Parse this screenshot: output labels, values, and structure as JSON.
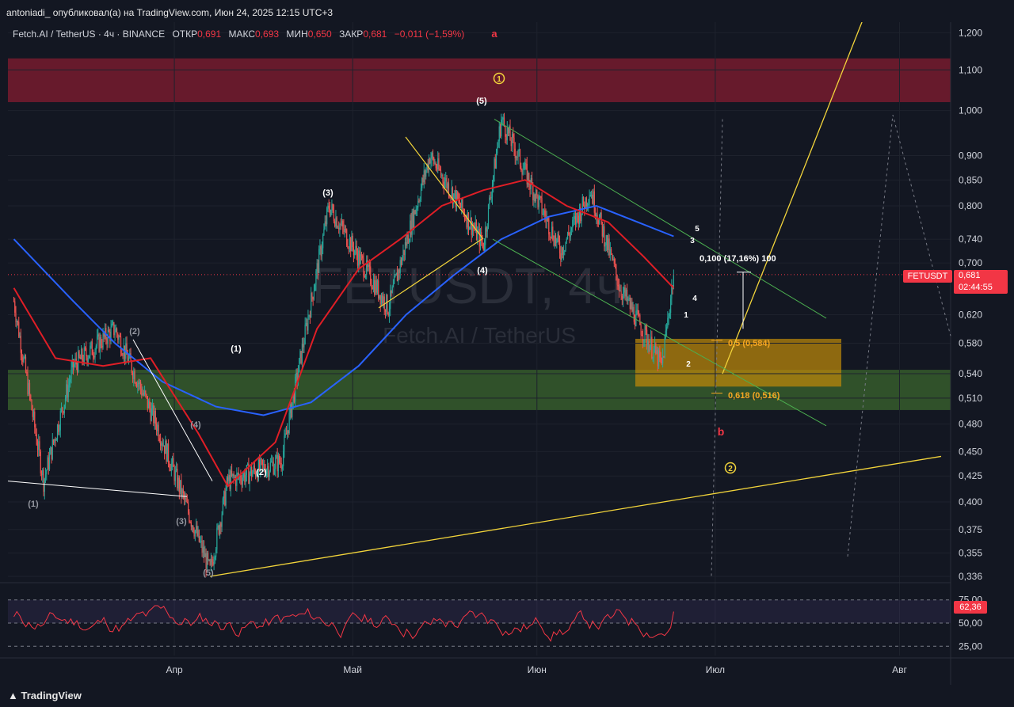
{
  "header": {
    "publisher": "antoniadi_ опубликовал(а) на TradingView.com, Июн 24, 2025 12:15 UTC+3"
  },
  "legend": {
    "symbol": "Fetch.AI / TetherUS · 4ч · BINANCE",
    "open_label": "ОТКР",
    "open": "0,691",
    "high_label": "МАКС",
    "high": "0,693",
    "low_label": "МИН",
    "low": "0,650",
    "close_label": "ЗАКР",
    "close": "0,681",
    "change": "−0,011 (−1,59%)"
  },
  "watermark": {
    "ticker": "FETUSDT, 4ч",
    "name": "Fetch.AI / TetherUS"
  },
  "price_tag": {
    "symbol": "FETUSDT",
    "price": "0,681",
    "countdown": "02:44:55"
  },
  "rsi_tag": {
    "value": "62,36"
  },
  "footer": {
    "brand": "TradingView"
  },
  "colors": {
    "up": "#26a69a",
    "down": "#ef5350",
    "ma_fast": "#e01e26",
    "ma_slow": "#2962ff",
    "accent_yellow": "#f2d43b"
  },
  "chart_data": {
    "type": "candlestick",
    "y_scale": "log",
    "ylim": [
      0.336,
      1.23
    ],
    "y_ticks": [
      "1,200",
      "1,100",
      "1,000",
      "0,900",
      "0,850",
      "0,800",
      "0,740",
      "0,700",
      "0,620",
      "0,580",
      "0,540",
      "0,510",
      "0,480",
      "0,450",
      "0,425",
      "0,400",
      "0,375",
      "0,355",
      "0,336"
    ],
    "y_tick_values": [
      1.2,
      1.1,
      1.0,
      0.9,
      0.85,
      0.8,
      0.74,
      0.7,
      0.62,
      0.58,
      0.54,
      0.51,
      0.48,
      0.45,
      0.425,
      0.4,
      0.375,
      0.355,
      0.336
    ],
    "x_ticks": [
      "Апр",
      "Май",
      "Июн",
      "Июл",
      "Авг"
    ],
    "x_tick_dates": [
      "2025-04-01",
      "2025-05-01",
      "2025-06-01",
      "2025-07-01",
      "2025-08-01"
    ],
    "key_prices": [
      {
        "date": "2025-03-05",
        "price": 0.64
      },
      {
        "date": "2025-03-10",
        "price": 0.42
      },
      {
        "date": "2025-03-15",
        "price": 0.55
      },
      {
        "date": "2025-03-22",
        "price": 0.6
      },
      {
        "date": "2025-03-29",
        "price": 0.48
      },
      {
        "date": "2025-04-07",
        "price": 0.34
      },
      {
        "date": "2025-04-10",
        "price": 0.42
      },
      {
        "date": "2025-04-19",
        "price": 0.44
      },
      {
        "date": "2025-04-27",
        "price": 0.8
      },
      {
        "date": "2025-05-07",
        "price": 0.63
      },
      {
        "date": "2025-05-14",
        "price": 0.9
      },
      {
        "date": "2025-05-23",
        "price": 0.73
      },
      {
        "date": "2025-05-26",
        "price": 0.98
      },
      {
        "date": "2025-06-05",
        "price": 0.72
      },
      {
        "date": "2025-06-10",
        "price": 0.83
      },
      {
        "date": "2025-06-15",
        "price": 0.66
      },
      {
        "date": "2025-06-22",
        "price": 0.55
      },
      {
        "date": "2025-06-24",
        "price": 0.681
      }
    ],
    "ma_fast": [
      {
        "date": "2025-03-05",
        "price": 0.66
      },
      {
        "date": "2025-03-12",
        "price": 0.56
      },
      {
        "date": "2025-03-20",
        "price": 0.55
      },
      {
        "date": "2025-03-28",
        "price": 0.56
      },
      {
        "date": "2025-04-05",
        "price": 0.47
      },
      {
        "date": "2025-04-10",
        "price": 0.415
      },
      {
        "date": "2025-04-18",
        "price": 0.46
      },
      {
        "date": "2025-04-25",
        "price": 0.6
      },
      {
        "date": "2025-05-02",
        "price": 0.69
      },
      {
        "date": "2025-05-09",
        "price": 0.74
      },
      {
        "date": "2025-05-16",
        "price": 0.8
      },
      {
        "date": "2025-05-23",
        "price": 0.83
      },
      {
        "date": "2025-05-30",
        "price": 0.85
      },
      {
        "date": "2025-06-06",
        "price": 0.8
      },
      {
        "date": "2025-06-13",
        "price": 0.77
      },
      {
        "date": "2025-06-19",
        "price": 0.71
      },
      {
        "date": "2025-06-24",
        "price": 0.66
      }
    ],
    "ma_slow": [
      {
        "date": "2025-03-05",
        "price": 0.74
      },
      {
        "date": "2025-03-15",
        "price": 0.64
      },
      {
        "date": "2025-03-22",
        "price": 0.58
      },
      {
        "date": "2025-03-30",
        "price": 0.53
      },
      {
        "date": "2025-04-08",
        "price": 0.5
      },
      {
        "date": "2025-04-16",
        "price": 0.49
      },
      {
        "date": "2025-04-24",
        "price": 0.505
      },
      {
        "date": "2025-05-02",
        "price": 0.55
      },
      {
        "date": "2025-05-10",
        "price": 0.62
      },
      {
        "date": "2025-05-18",
        "price": 0.68
      },
      {
        "date": "2025-05-26",
        "price": 0.74
      },
      {
        "date": "2025-06-03",
        "price": 0.78
      },
      {
        "date": "2025-06-11",
        "price": 0.8
      },
      {
        "date": "2025-06-18",
        "price": 0.77
      },
      {
        "date": "2025-06-24",
        "price": 0.745
      }
    ],
    "rsi": {
      "ylim": [
        15,
        85
      ],
      "levels": [
        "75,00",
        "50,00",
        "25,00"
      ],
      "level_values": [
        75,
        50,
        25
      ],
      "current": 62.36
    },
    "zones": [
      {
        "label": "resistance",
        "color": "#8b1d30",
        "from": 1.02,
        "to": 1.13
      },
      {
        "label": "support",
        "color": "#3d6b2e",
        "from": 0.496,
        "to": 0.545
      },
      {
        "label": "fib-box",
        "color": "#b8860b",
        "from": 0.524,
        "to": 0.586
      }
    ],
    "annotations": [
      {
        "text": "a",
        "color": "#f23645"
      },
      {
        "text": "1",
        "color": "#f2d43b",
        "circled": true
      },
      {
        "text": "(5)"
      },
      {
        "text": "(3)"
      },
      {
        "text": "(4)"
      },
      {
        "text": "(1)"
      },
      {
        "text": "(2)"
      },
      {
        "text": "(2)",
        "color": "#9598a1"
      },
      {
        "text": "(4)",
        "color": "#9598a1"
      },
      {
        "text": "(1)",
        "color": "#9598a1"
      },
      {
        "text": "(3)",
        "color": "#9598a1"
      },
      {
        "text": "(5)",
        "color": "#9598a1"
      },
      {
        "text": "5"
      },
      {
        "text": "3"
      },
      {
        "text": "4"
      },
      {
        "text": "1"
      },
      {
        "text": "2"
      },
      {
        "text": "b",
        "color": "#f23645"
      },
      {
        "text": "2",
        "color": "#f2d43b",
        "circled": true
      },
      {
        "text": "0,100 (17,16%) 100"
      },
      {
        "text": "0,5 (0,584)",
        "color": "#f5a623"
      },
      {
        "text": "0,618 (0,516)",
        "color": "#f5a623"
      }
    ]
  }
}
